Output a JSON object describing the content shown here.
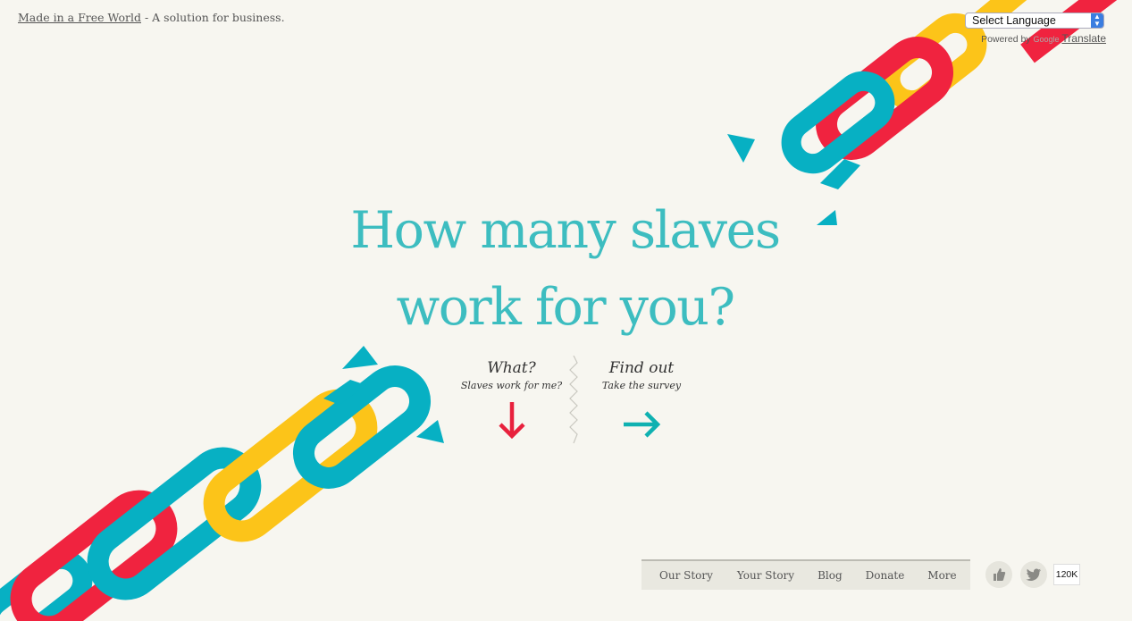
{
  "header": {
    "brand_link": "Made in a Free World",
    "brand_tagline": "- A solution for business."
  },
  "translate": {
    "select_value": "Select Language",
    "powered_by": "Powered by",
    "google_label": "Google",
    "translate_link": "Translate"
  },
  "hero": {
    "line1": "How many slaves",
    "line2": "work for you?"
  },
  "cta": {
    "what_title": "What?",
    "what_subtitle": "Slaves work for me?",
    "find_title": "Find out",
    "find_subtitle": "Take the survey"
  },
  "nav": {
    "items": [
      "Our Story",
      "Your Story",
      "Blog",
      "Donate",
      "More"
    ]
  },
  "social": {
    "like_icon": "thumbs-up-icon",
    "twitter_icon": "twitter-bird-icon",
    "count": "120K"
  },
  "colors": {
    "background": "#f7f6f0",
    "headline": "#3dbdc0",
    "chain_red": "#f0233f",
    "chain_yellow": "#fcc419",
    "chain_teal": "#07b0c3",
    "arrow_red": "#e8213d",
    "arrow_teal": "#0fb1b1"
  }
}
